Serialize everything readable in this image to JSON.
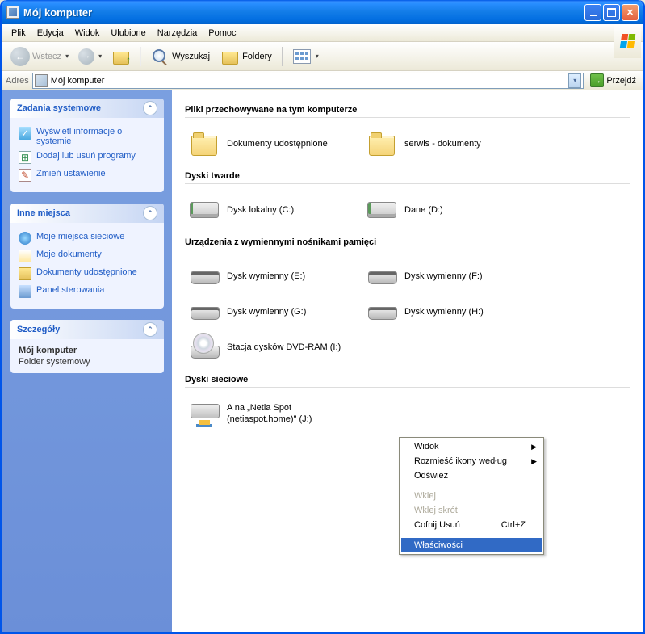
{
  "title": "Mój komputer",
  "menubar": [
    "Plik",
    "Edycja",
    "Widok",
    "Ulubione",
    "Narzędzia",
    "Pomoc"
  ],
  "toolbar": {
    "back": "Wstecz",
    "search": "Wyszukaj",
    "folders": "Foldery"
  },
  "addressbar": {
    "label": "Adres",
    "value": "Mój komputer",
    "go": "Przejdź"
  },
  "sidebar": {
    "tasks": {
      "title": "Zadania systemowe",
      "items": [
        "Wyświetl informacje o systemie",
        "Dodaj lub usuń programy",
        "Zmień ustawienie"
      ]
    },
    "places": {
      "title": "Inne miejsca",
      "items": [
        "Moje miejsca sieciowe",
        "Moje dokumenty",
        "Dokumenty udostępnione",
        "Panel sterowania"
      ]
    },
    "details": {
      "title": "Szczegóły",
      "name": "Mój komputer",
      "type": "Folder systemowy"
    }
  },
  "main": {
    "sections": {
      "stored": {
        "title": "Pliki przechowywane na tym komputerze",
        "items": [
          "Dokumenty udostępnione",
          "serwis - dokumenty"
        ]
      },
      "hdd": {
        "title": "Dyski twarde",
        "items": [
          "Dysk lokalny (C:)",
          "Dane (D:)"
        ]
      },
      "removable": {
        "title": "Urządzenia z wymiennymi nośnikami pamięci",
        "items": [
          "Dysk wymienny (E:)",
          "Dysk wymienny (F:)",
          "Dysk wymienny (G:)",
          "Dysk wymienny (H:)",
          "Stacja dysków DVD-RAM (I:)"
        ]
      },
      "network": {
        "title": "Dyski sieciowe",
        "items": [
          "A na „Netia Spot (netiaspot.home)\" (J:)"
        ]
      }
    }
  },
  "contextmenu": {
    "view": "Widok",
    "arrange": "Rozmieść ikony według",
    "refresh": "Odśwież",
    "paste": "Wklej",
    "pasteShortcut": "Wklej skrót",
    "undo": "Cofnij Usuń",
    "undoKey": "Ctrl+Z",
    "properties": "Właściwości"
  }
}
